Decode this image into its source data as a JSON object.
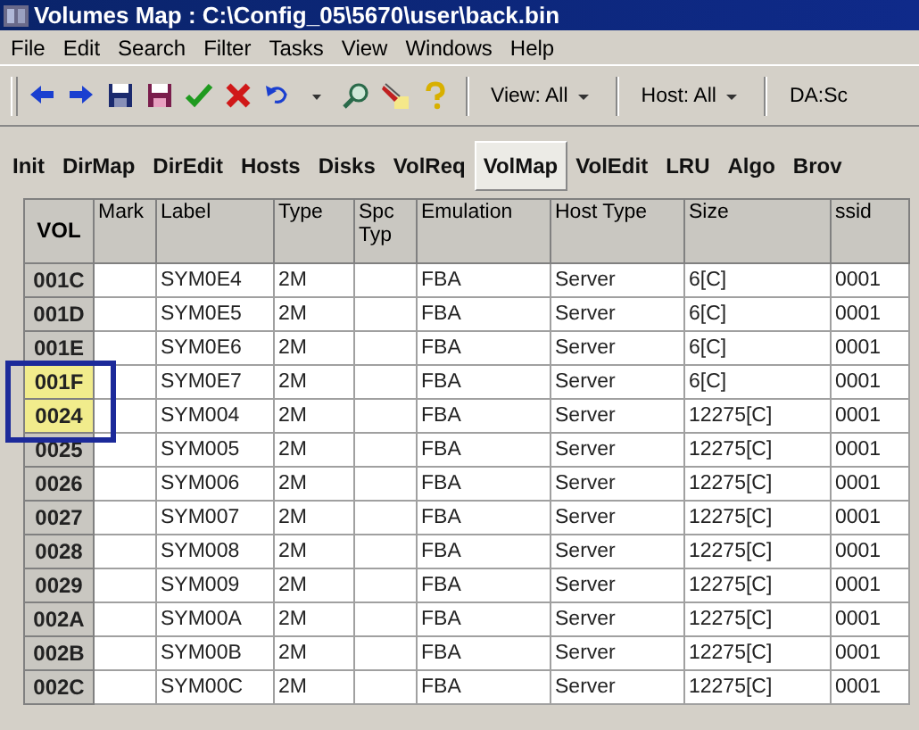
{
  "window": {
    "title": "Volumes Map : C:\\Config_05\\5670\\user\\back.bin"
  },
  "menu": [
    "File",
    "Edit",
    "Search",
    "Filter",
    "Tasks",
    "View",
    "Windows",
    "Help"
  ],
  "toolbar": {
    "dropdowns": [
      {
        "label": "View: All"
      },
      {
        "label": "Host: All"
      },
      {
        "label": "DA:Sc"
      }
    ]
  },
  "tabs": [
    {
      "label": "Init",
      "selected": false
    },
    {
      "label": "DirMap",
      "selected": false
    },
    {
      "label": "DirEdit",
      "selected": false
    },
    {
      "label": "Hosts",
      "selected": false
    },
    {
      "label": "Disks",
      "selected": false
    },
    {
      "label": "VolReq",
      "selected": false
    },
    {
      "label": "VolMap",
      "selected": true
    },
    {
      "label": "VolEdit",
      "selected": false
    },
    {
      "label": "LRU",
      "selected": false
    },
    {
      "label": "Algo",
      "selected": false
    },
    {
      "label": "Brov",
      "selected": false
    }
  ],
  "table": {
    "columns": [
      "VOL",
      "Mark",
      "Label",
      "Type",
      "Spc Typ",
      "Emulation",
      "Host Type",
      "Size",
      "ssid"
    ],
    "rows": [
      {
        "highlighted": false,
        "cells": [
          "001C",
          "",
          "SYM0E4",
          "2M",
          "",
          "FBA",
          "Server",
          "6[C]",
          "0001"
        ]
      },
      {
        "highlighted": false,
        "cells": [
          "001D",
          "",
          "SYM0E5",
          "2M",
          "",
          "FBA",
          "Server",
          "6[C]",
          "0001"
        ]
      },
      {
        "highlighted": false,
        "cells": [
          "001E",
          "",
          "SYM0E6",
          "2M",
          "",
          "FBA",
          "Server",
          "6[C]",
          "0001"
        ]
      },
      {
        "highlighted": true,
        "cells": [
          "001F",
          "",
          "SYM0E7",
          "2M",
          "",
          "FBA",
          "Server",
          "6[C]",
          "0001"
        ]
      },
      {
        "highlighted": true,
        "cells": [
          "0024",
          "",
          "SYM004",
          "2M",
          "",
          "FBA",
          "Server",
          "12275[C]",
          "0001"
        ]
      },
      {
        "highlighted": false,
        "cells": [
          "0025",
          "",
          "SYM005",
          "2M",
          "",
          "FBA",
          "Server",
          "12275[C]",
          "0001"
        ]
      },
      {
        "highlighted": false,
        "cells": [
          "0026",
          "",
          "SYM006",
          "2M",
          "",
          "FBA",
          "Server",
          "12275[C]",
          "0001"
        ]
      },
      {
        "highlighted": false,
        "cells": [
          "0027",
          "",
          "SYM007",
          "2M",
          "",
          "FBA",
          "Server",
          "12275[C]",
          "0001"
        ]
      },
      {
        "highlighted": false,
        "cells": [
          "0028",
          "",
          "SYM008",
          "2M",
          "",
          "FBA",
          "Server",
          "12275[C]",
          "0001"
        ]
      },
      {
        "highlighted": false,
        "cells": [
          "0029",
          "",
          "SYM009",
          "2M",
          "",
          "FBA",
          "Server",
          "12275[C]",
          "0001"
        ]
      },
      {
        "highlighted": false,
        "cells": [
          "002A",
          "",
          "SYM00A",
          "2M",
          "",
          "FBA",
          "Server",
          "12275[C]",
          "0001"
        ]
      },
      {
        "highlighted": false,
        "cells": [
          "002B",
          "",
          "SYM00B",
          "2M",
          "",
          "FBA",
          "Server",
          "12275[C]",
          "0001"
        ]
      },
      {
        "highlighted": false,
        "cells": [
          "002C",
          "",
          "SYM00C",
          "2M",
          "",
          "FBA",
          "Server",
          "12275[C]",
          "0001"
        ]
      }
    ]
  }
}
